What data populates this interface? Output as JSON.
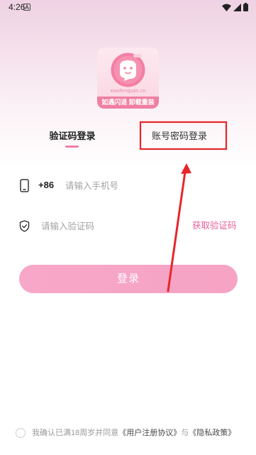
{
  "status_bar": {
    "time": "4:26",
    "notification_icon": "a-notification-icon",
    "wifi_icon": "wifi-icon",
    "signal_icon": "signal-icon",
    "battery_icon": "battery-icon"
  },
  "logo": {
    "site": "xiaofenquan.cn",
    "banner": "如遇闪退 卸载重装"
  },
  "tabs": [
    {
      "label": "验证码登录",
      "active": true
    },
    {
      "label": "账号密码登录",
      "active": false
    }
  ],
  "phone_field": {
    "icon": "phone-icon",
    "country_code": "+86",
    "placeholder": "请输入手机号"
  },
  "code_field": {
    "icon": "shield-icon",
    "placeholder": "请输入验证码",
    "get_code_label": "获取验证码"
  },
  "login_button": {
    "label": "登录"
  },
  "agreement": {
    "checked": false,
    "prefix": "我确认已满18周岁并同意",
    "terms_link": "《用户注册协议》",
    "conjunction": "与",
    "privacy_link": "《隐私政策》"
  },
  "colors": {
    "accent": "#f07fa3",
    "link_pink": "#e4609a",
    "button": "#f7a7c8",
    "annotation_red": "#e8262a"
  }
}
